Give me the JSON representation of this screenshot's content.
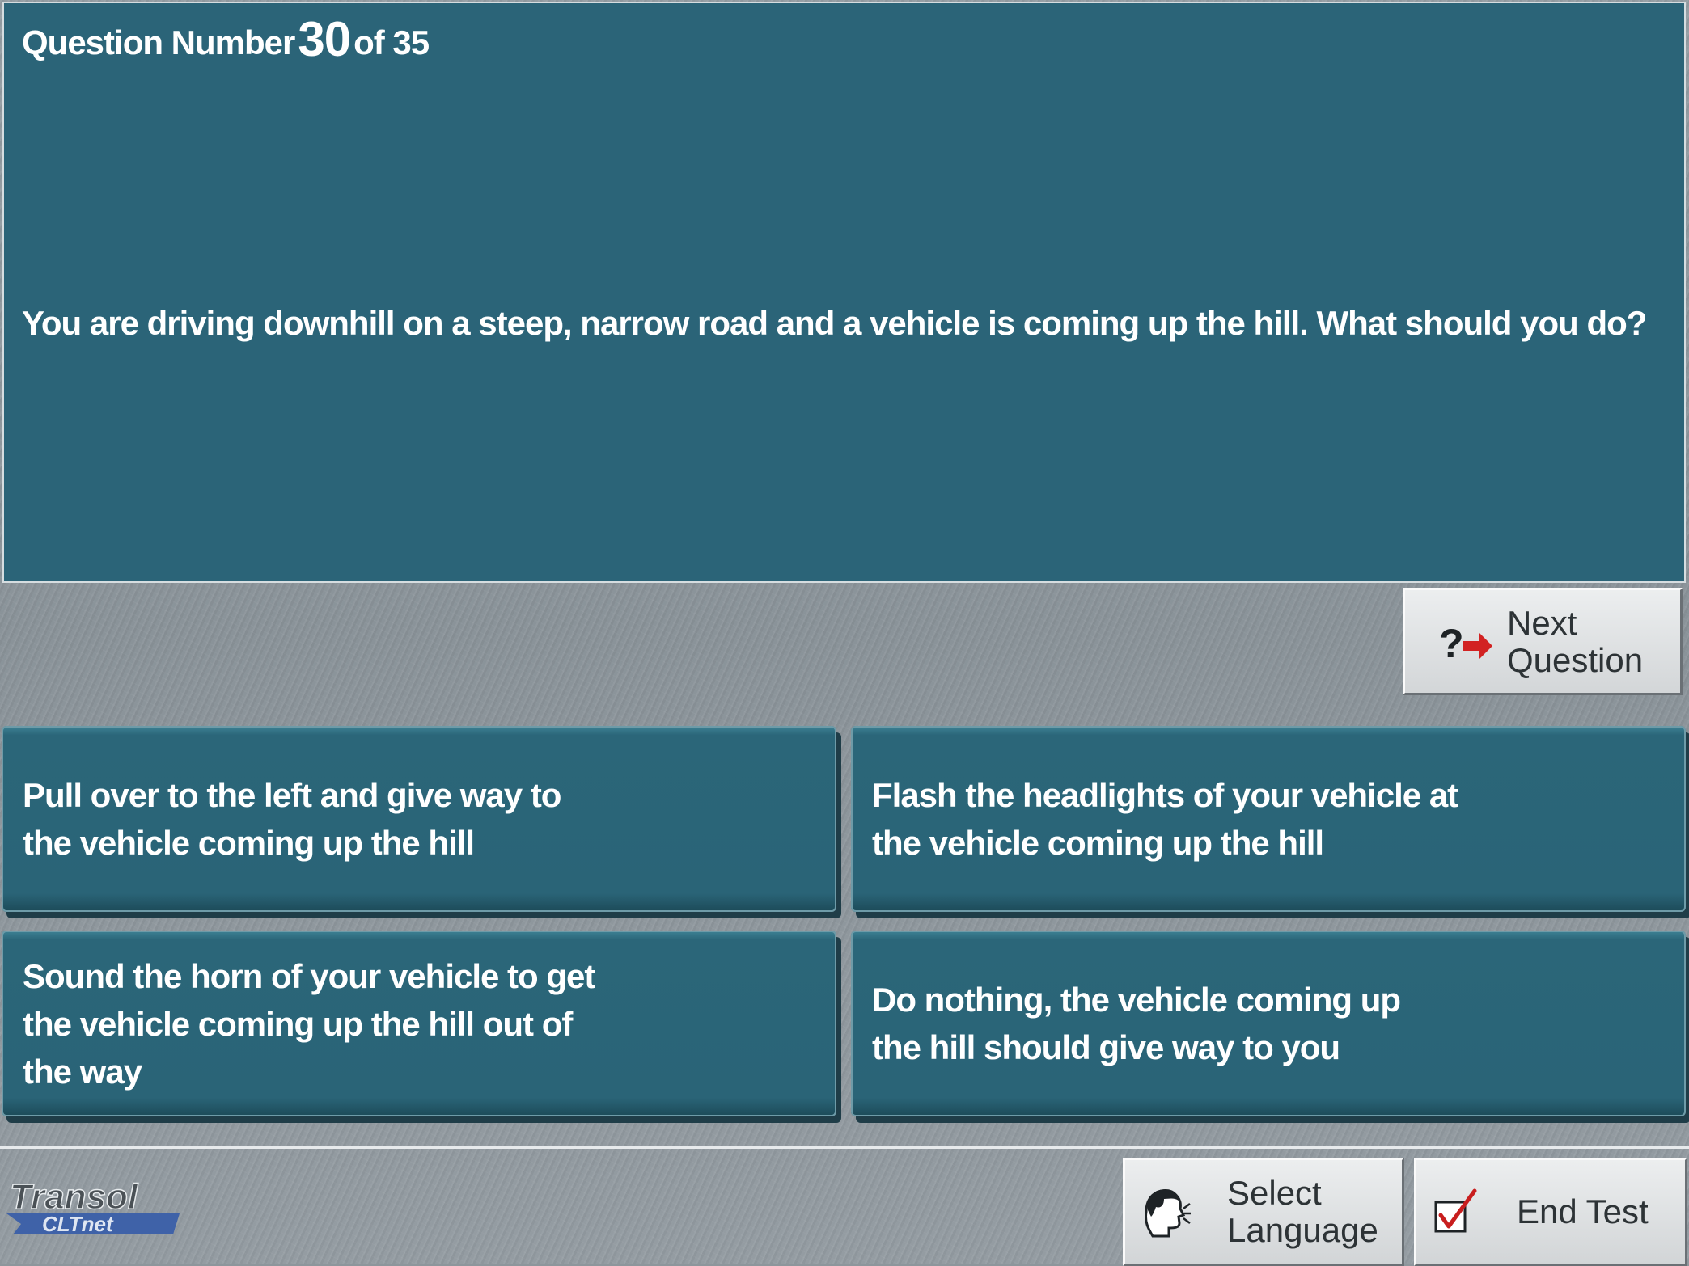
{
  "question": {
    "prefix": "Question Number",
    "number": "30",
    "suffix": "of 35",
    "text": "You are driving downhill on a steep, narrow road and a vehicle is coming up the hill. What should you do?"
  },
  "next_button": {
    "line1": "Next",
    "line2": "Question",
    "icon": "question-arrow-icon"
  },
  "answers": [
    {
      "text": "Pull over to the left and give way to the vehicle coming up the hill"
    },
    {
      "text": "Flash the headlights of your vehicle at the vehicle coming up the hill"
    },
    {
      "text": "Sound the horn of your vehicle to get the vehicle coming up the hill out of the way"
    },
    {
      "text": "Do nothing, the vehicle coming up the hill should give way to you"
    }
  ],
  "footer": {
    "logo_main": "Transol",
    "logo_sub": "CLTnet",
    "select_language": {
      "line1": "Select",
      "line2": "Language",
      "icon": "speaking-head-icon"
    },
    "end_test": {
      "label": "End Test",
      "icon": "checkbox-checked-icon"
    }
  },
  "colors": {
    "panel": "#2b6478",
    "answer": "#2a6477",
    "background": "#8d969c",
    "button": "#dcdfe1",
    "arrow_red": "#d22222",
    "logo_blue": "#3f62a8"
  }
}
